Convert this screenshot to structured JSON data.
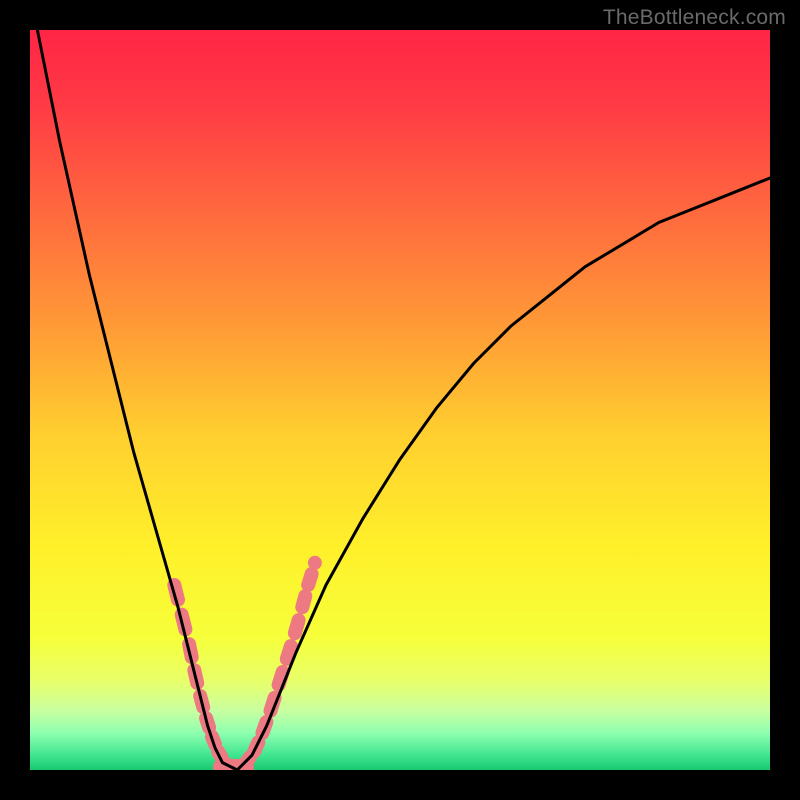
{
  "watermark": "TheBottleneck.com",
  "chart_data": {
    "type": "line",
    "title": "",
    "xlabel": "",
    "ylabel": "",
    "xlim": [
      0,
      100
    ],
    "ylim": [
      0,
      100
    ],
    "x": [
      0,
      2,
      4,
      6,
      8,
      10,
      12,
      14,
      16,
      18,
      20,
      21,
      22,
      23,
      24,
      25,
      26,
      28,
      30,
      32,
      34,
      36,
      40,
      45,
      50,
      55,
      60,
      65,
      70,
      75,
      80,
      85,
      90,
      95,
      100
    ],
    "y": [
      105,
      95,
      85,
      76,
      67,
      59,
      51,
      43,
      36,
      29,
      22,
      18,
      14,
      10,
      6,
      3,
      1,
      0,
      2,
      6,
      11,
      16,
      25,
      34,
      42,
      49,
      55,
      60,
      64,
      68,
      71,
      74,
      76,
      78,
      80
    ],
    "series": [
      {
        "name": "curve",
        "x": [
          0,
          2,
          4,
          6,
          8,
          10,
          12,
          14,
          16,
          18,
          20,
          21,
          22,
          23,
          24,
          25,
          26,
          28,
          30,
          32,
          34,
          36,
          40,
          45,
          50,
          55,
          60,
          65,
          70,
          75,
          80,
          85,
          90,
          95,
          100
        ],
        "y": [
          105,
          95,
          85,
          76,
          67,
          59,
          51,
          43,
          36,
          29,
          22,
          18,
          14,
          10,
          6,
          3,
          1,
          0,
          2,
          6,
          11,
          16,
          25,
          34,
          42,
          49,
          55,
          60,
          64,
          68,
          71,
          74,
          76,
          78,
          80
        ]
      }
    ],
    "highlight_points": {
      "x": [
        19.5,
        20.5,
        21.5,
        22.2,
        23.0,
        23.8,
        24.6,
        25.4,
        26.3,
        27.2,
        28.2,
        29.2,
        30.3,
        31.4,
        32.5,
        33.6,
        34.7,
        35.8,
        36.8,
        37.6,
        38.5
      ],
      "y": [
        25,
        21,
        17,
        13.5,
        10,
        7,
        4.5,
        2.5,
        1,
        0.3,
        0.2,
        1,
        2.5,
        5,
        8,
        11.5,
        15,
        18.5,
        22,
        25,
        28
      ]
    },
    "gradient_stops": [
      {
        "pos": 0.0,
        "color": "#ff2545"
      },
      {
        "pos": 0.1,
        "color": "#ff3a45"
      },
      {
        "pos": 0.25,
        "color": "#ff6a3e"
      },
      {
        "pos": 0.4,
        "color": "#ff9a36"
      },
      {
        "pos": 0.55,
        "color": "#ffd02f"
      },
      {
        "pos": 0.7,
        "color": "#fff02a"
      },
      {
        "pos": 0.82,
        "color": "#f6ff3a"
      },
      {
        "pos": 0.88,
        "color": "#e8ff6a"
      },
      {
        "pos": 0.92,
        "color": "#c8ffa0"
      },
      {
        "pos": 0.95,
        "color": "#8effb0"
      },
      {
        "pos": 0.98,
        "color": "#40e590"
      },
      {
        "pos": 1.0,
        "color": "#18c870"
      }
    ],
    "highlight_color": "#ed7a82",
    "curve_color": "#000000"
  }
}
